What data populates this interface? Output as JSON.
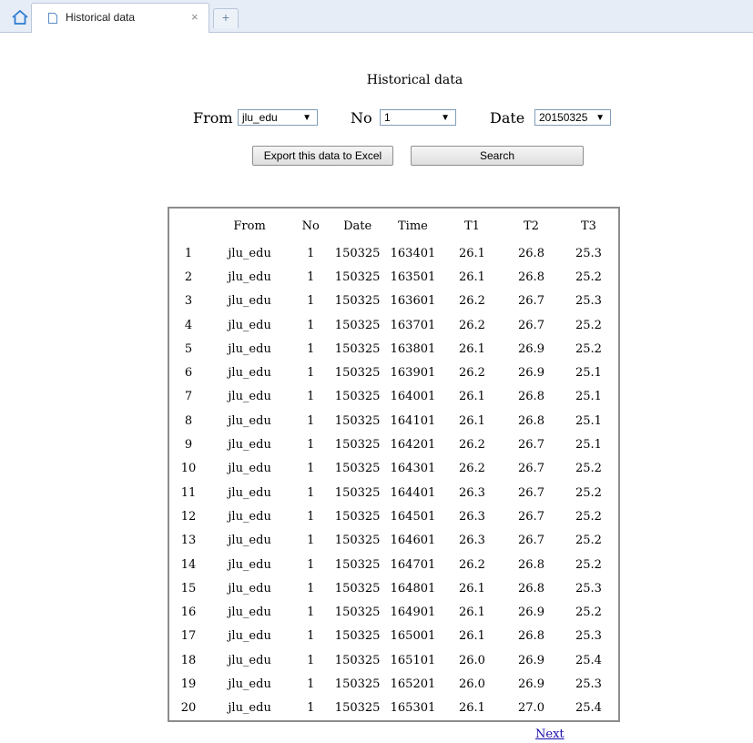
{
  "browser": {
    "tab_title": "Historical data",
    "tab_close": "×",
    "new_tab": "+"
  },
  "page": {
    "title": "Historical data",
    "filters": {
      "from_label": "From",
      "from_value": "jlu_edu",
      "no_label": "No",
      "no_value": "1",
      "date_label": "Date",
      "date_value": "20150325",
      "dropdown_arrow": "▼"
    },
    "buttons": {
      "export_label": "Export this data to Excel",
      "search_label": "Search"
    },
    "table": {
      "headers": [
        "",
        "From",
        "No",
        "Date",
        "Time",
        "T1",
        "T2",
        "T3"
      ],
      "rows": [
        [
          "1",
          "jlu_edu",
          "1",
          "150325",
          "163401",
          "26.1",
          "26.8",
          "25.3"
        ],
        [
          "2",
          "jlu_edu",
          "1",
          "150325",
          "163501",
          "26.1",
          "26.8",
          "25.2"
        ],
        [
          "3",
          "jlu_edu",
          "1",
          "150325",
          "163601",
          "26.2",
          "26.7",
          "25.3"
        ],
        [
          "4",
          "jlu_edu",
          "1",
          "150325",
          "163701",
          "26.2",
          "26.7",
          "25.2"
        ],
        [
          "5",
          "jlu_edu",
          "1",
          "150325",
          "163801",
          "26.1",
          "26.9",
          "25.2"
        ],
        [
          "6",
          "jlu_edu",
          "1",
          "150325",
          "163901",
          "26.2",
          "26.9",
          "25.1"
        ],
        [
          "7",
          "jlu_edu",
          "1",
          "150325",
          "164001",
          "26.1",
          "26.8",
          "25.1"
        ],
        [
          "8",
          "jlu_edu",
          "1",
          "150325",
          "164101",
          "26.1",
          "26.8",
          "25.1"
        ],
        [
          "9",
          "jlu_edu",
          "1",
          "150325",
          "164201",
          "26.2",
          "26.7",
          "25.1"
        ],
        [
          "10",
          "jlu_edu",
          "1",
          "150325",
          "164301",
          "26.2",
          "26.7",
          "25.2"
        ],
        [
          "11",
          "jlu_edu",
          "1",
          "150325",
          "164401",
          "26.3",
          "26.7",
          "25.2"
        ],
        [
          "12",
          "jlu_edu",
          "1",
          "150325",
          "164501",
          "26.3",
          "26.7",
          "25.2"
        ],
        [
          "13",
          "jlu_edu",
          "1",
          "150325",
          "164601",
          "26.3",
          "26.7",
          "25.2"
        ],
        [
          "14",
          "jlu_edu",
          "1",
          "150325",
          "164701",
          "26.2",
          "26.8",
          "25.2"
        ],
        [
          "15",
          "jlu_edu",
          "1",
          "150325",
          "164801",
          "26.1",
          "26.8",
          "25.3"
        ],
        [
          "16",
          "jlu_edu",
          "1",
          "150325",
          "164901",
          "26.1",
          "26.9",
          "25.2"
        ],
        [
          "17",
          "jlu_edu",
          "1",
          "150325",
          "165001",
          "26.1",
          "26.8",
          "25.3"
        ],
        [
          "18",
          "jlu_edu",
          "1",
          "150325",
          "165101",
          "26.0",
          "26.9",
          "25.4"
        ],
        [
          "19",
          "jlu_edu",
          "1",
          "150325",
          "165201",
          "26.0",
          "26.9",
          "25.3"
        ],
        [
          "20",
          "jlu_edu",
          "1",
          "150325",
          "165301",
          "26.1",
          "27.0",
          "25.4"
        ]
      ]
    },
    "pagination": {
      "next_label": "Next"
    }
  }
}
